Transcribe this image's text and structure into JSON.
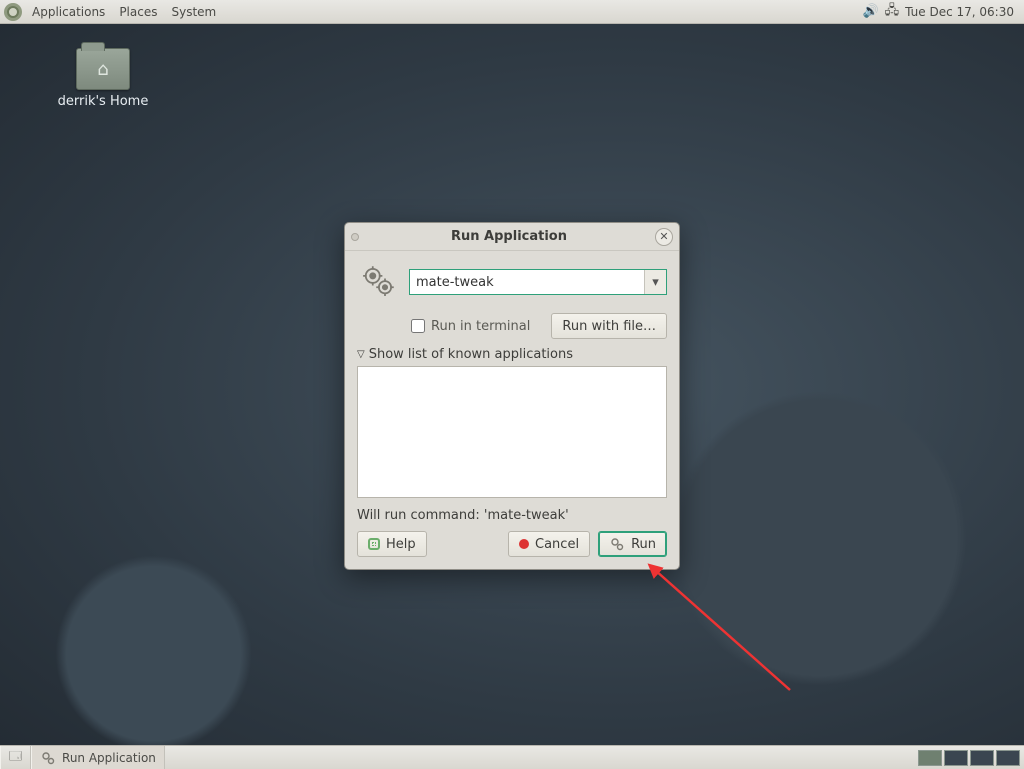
{
  "panel": {
    "menus": [
      "Applications",
      "Places",
      "System"
    ],
    "clock": "Tue Dec 17, 06:30"
  },
  "desktop": {
    "home_icon_label": "derrik's Home"
  },
  "dialog": {
    "title": "Run Application",
    "command_value": "mate-tweak",
    "run_in_terminal_label": "Run in terminal",
    "run_with_file_label": "Run with file…",
    "expander_label": "Show list of known applications",
    "status_text": "Will run command: 'mate-tweak'",
    "help_label": "Help",
    "cancel_label": "Cancel",
    "run_label": "Run"
  },
  "taskbar": {
    "task_label": "Run Application"
  }
}
